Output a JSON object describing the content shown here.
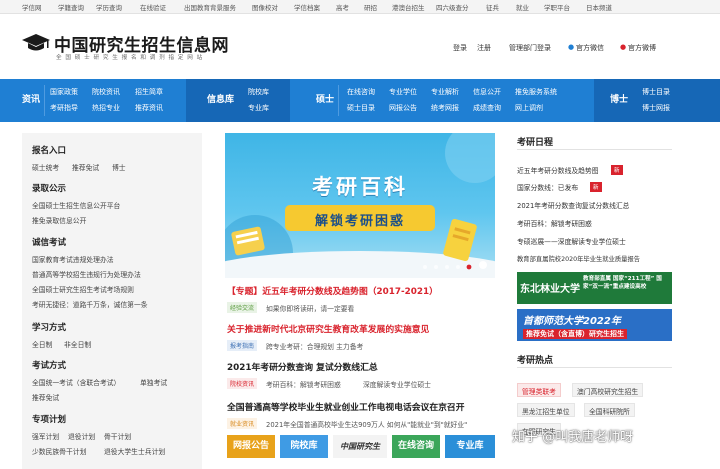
{
  "topbar": [
    "学信网",
    "学籍查询",
    "学历查询",
    "在线验证",
    "出国教育背景服务",
    "图像校对",
    "学信档案",
    "高考",
    "研招",
    "港澳台招生",
    "征兵",
    "就业",
    "学职平台",
    "日本频道",
    "四六级查分",
    "研招"
  ],
  "header": {
    "title": "中国研究生招生信息网",
    "subtitle": "全 国 硕 士 研 究 生 报 名 和 调 剂 指 定 网 站",
    "login": "登录",
    "register": "注册",
    "admin": "管理部门登录",
    "wechat": "官方微信",
    "weibo": "官方微博"
  },
  "nav": {
    "zixun": {
      "label": "资讯",
      "links": [
        "国家政策",
        "院校资讯",
        "招生简章",
        "考研指导",
        "热招专业",
        "推荐资讯"
      ]
    },
    "xinxiku": {
      "label": "信息库",
      "links": [
        "院校库",
        "专业库"
      ]
    },
    "shuoshi": {
      "label": "硕士",
      "links": [
        "在线咨询",
        "专业学位",
        "专业解析",
        "信息公开",
        "推免服务系统",
        "硕士目录",
        "网报公告",
        "统考网报",
        "成绩查询",
        "网上调剂"
      ]
    },
    "boshi": {
      "label": "博士",
      "links": [
        "博士目录",
        "博士网报"
      ]
    }
  },
  "left": {
    "baoming": {
      "title": "报名入口",
      "links": [
        "硕士统考",
        "推荐免试",
        "博士"
      ]
    },
    "luqu": {
      "title": "录取公示",
      "links": [
        "全国硕士生招生信息公开平台",
        "推免录取信息公开"
      ]
    },
    "chengxin": {
      "title": "诚信考试",
      "links": [
        "国家教育考试违规处理办法",
        "普通高等学校招生违规行为处理办法",
        "全国硕士研究生招生考试考场规则",
        "考研无捷径：道路千万条，诚信第一条"
      ]
    },
    "xuexi": {
      "title": "学习方式",
      "links": [
        "全日制",
        "非全日制"
      ]
    },
    "kaoshi": {
      "title": "考试方式",
      "links": [
        "全国统一考试（含联合考试）",
        "单独考试",
        "推荐免试"
      ]
    },
    "zhuanxiang": {
      "title": "专项计划",
      "links": [
        "强军计划",
        "退役计划",
        "骨干计划",
        "少数民族骨干计划",
        "退役大学生士兵计划"
      ]
    }
  },
  "banner": {
    "title": "考研百科",
    "subtitle": "解锁考研困惑"
  },
  "mid": {
    "n1": {
      "title": "【专题】近五年考研分数线及趋势图（2017-2021）",
      "tag": "经验交流",
      "desc": "如果你即将读研，请一定要看"
    },
    "n2": {
      "title": "关于推进新时代北京研究生教育改革发展的实施意见",
      "tag": "报考指南",
      "desc": "跨专业考研：合理规划 主力备考"
    },
    "n3": {
      "title": "2021年考研分数查询 复试分数线汇总",
      "tag": "院校资讯",
      "desc1": "考研百科：解锁考研困惑",
      "desc2": "深度解读专业学位硕士"
    },
    "n4": {
      "title": "全国普通高等学校毕业生就业创业工作电视电话会议在京召开",
      "tag": "就业资讯",
      "desc": "2021年全国普通高校毕业生达909万人 如何从\"能就业\"到\"就好业\""
    },
    "buttons": [
      "网报公告",
      "院校库",
      "中国研究生",
      "在线咨询",
      "专业库"
    ]
  },
  "right": {
    "schedule": {
      "title": "考研日程",
      "links": [
        "近五年考研分数线及趋势图",
        "国家分数线：已发布",
        "2021年考研分数查询复试分数线汇总",
        "考研百科：解锁考研困惑",
        "专硕巡展——深度解读专业学位硕士",
        "教育部直属院校2020年毕业生就业质量报告"
      ]
    },
    "new_badge": "新",
    "banner1": {
      "name": "东北林业大学",
      "text": "教育部直属 国家“211工程” 国家“双一流”重点建设高校"
    },
    "banner2": {
      "title": "首都师范大学2022年",
      "sub": "推荐免试（含直博）研究生招生"
    },
    "hot": {
      "title": "考研热点",
      "tags": [
        "管理类联考",
        "澳门高校研究生招生",
        "黑龙江招生单位",
        "全国科研院所",
        "在职研究生"
      ]
    }
  },
  "watermark": "知乎 @叫我唐老师呀",
  "colors": {
    "nav": "#1f7fd3",
    "red": "#d9232d",
    "accent": "#1f7fd3"
  }
}
